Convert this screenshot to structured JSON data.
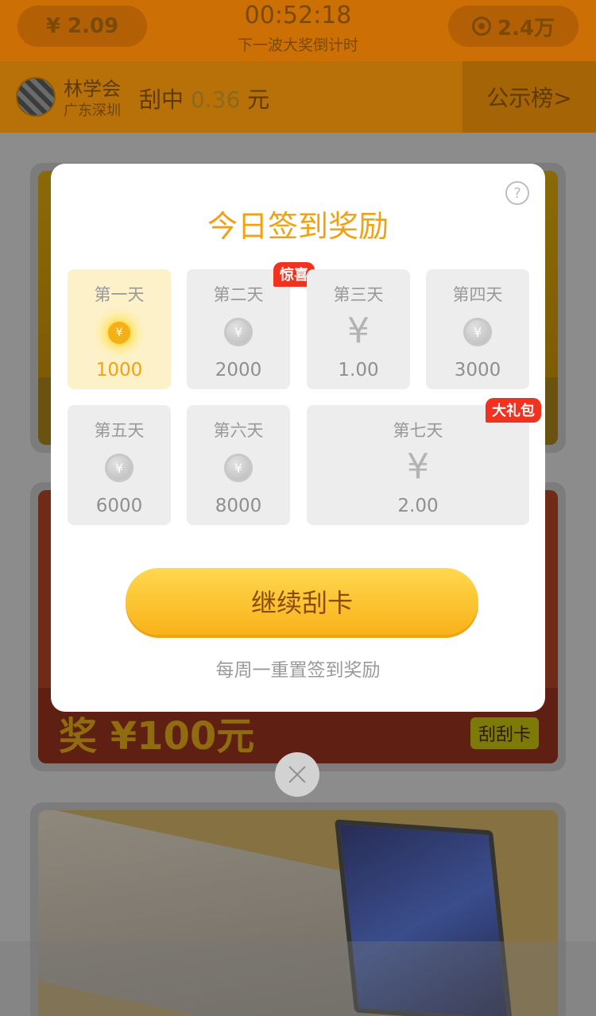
{
  "header": {
    "balance": "¥ 2.09",
    "countdown": "00:52:18",
    "countdown_label": "下一波大奖倒计时",
    "coins": "2.4万"
  },
  "user": {
    "name": "林学会",
    "location": "广东深圳",
    "won_prefix": "刮中",
    "won_amount": "0.36",
    "won_unit": "元",
    "board_label": "公示榜>"
  },
  "cards": {
    "card2_prize": "奖 ¥100元",
    "card2_tag": "刮刮卡"
  },
  "modal": {
    "title": "今日签到奖励",
    "help_icon": "?",
    "days": [
      {
        "label": "第一天",
        "value": "1000",
        "icon": "gold-coin-icon"
      },
      {
        "label": "第二天",
        "value": "2000",
        "icon": "coin-icon",
        "badge": "惊喜"
      },
      {
        "label": "第三天",
        "value": "1.00",
        "icon": "yen-icon"
      },
      {
        "label": "第四天",
        "value": "3000",
        "icon": "coin-icon"
      },
      {
        "label": "第五天",
        "value": "6000",
        "icon": "coin-icon"
      },
      {
        "label": "第六天",
        "value": "8000",
        "icon": "coin-icon"
      },
      {
        "label": "第七天",
        "value": "2.00",
        "icon": "yen-icon",
        "badge": "大礼包"
      }
    ],
    "coin_symbol": "¥",
    "continue_label": "继续刮卡",
    "reset_note": "每周一重置签到奖励"
  }
}
